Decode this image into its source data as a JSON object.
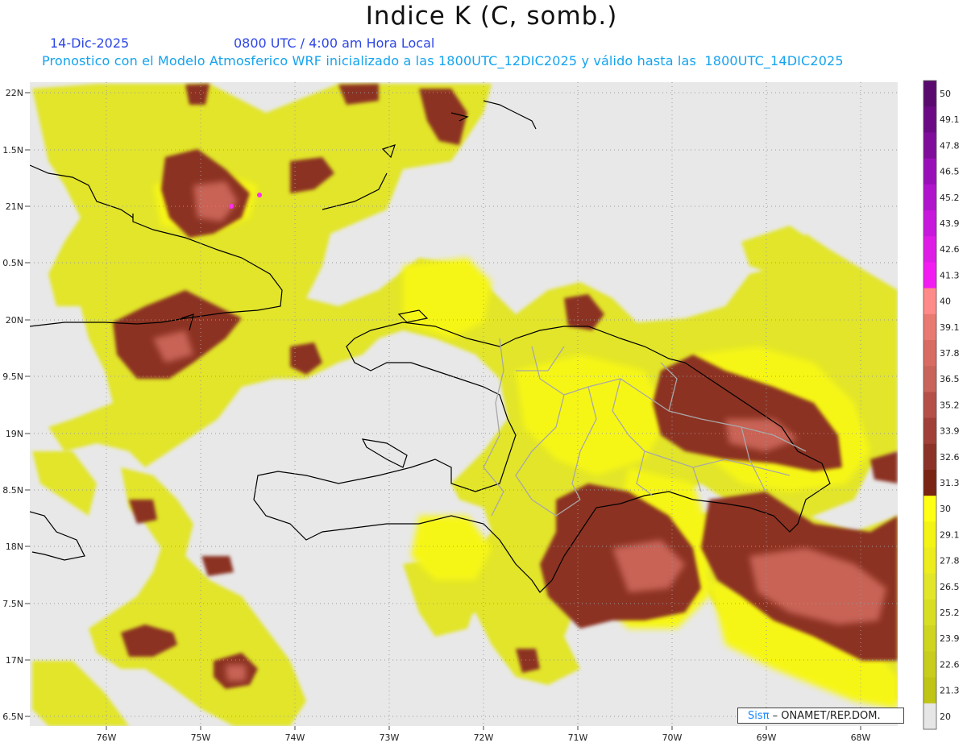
{
  "header": {
    "title": "Indice K (C, somb.)",
    "date": "14-Dic-2025",
    "time": "0800 UTC / 4:00 am Hora Local",
    "description": "Pronostico con el Modelo Atmosferico WRF inicializado a las 1800UTC_12DIC2025 y válido hasta las  1800UTC_14DIC2025"
  },
  "axes": {
    "lat_labels": [
      "22N",
      "1.5N",
      "21N",
      "0.5N",
      "20N",
      "9.5N",
      "19N",
      "8.5N",
      "18N",
      "7.5N",
      "17N",
      "6.5N"
    ],
    "lon_labels": [
      "76W",
      "75W",
      "74W",
      "73W",
      "72W",
      "71W",
      "70W",
      "69W",
      "68W"
    ]
  },
  "colorbar": {
    "labels": [
      "50",
      "49.1",
      "47.8",
      "46.5",
      "45.2",
      "43.9",
      "42.6",
      "41.3",
      "40",
      "39.1",
      "37.8",
      "36.5",
      "35.2",
      "33.9",
      "32.6",
      "31.3",
      "30",
      "29.1",
      "27.8",
      "26.5",
      "25.2",
      "23.9",
      "22.6",
      "21.3",
      "20"
    ],
    "colors": [
      "#5a0a6e",
      "#6b0a84",
      "#800c9c",
      "#9a10b8",
      "#b014cc",
      "#c818dc",
      "#de1ce6",
      "#f21cf2",
      "#ff8a8a",
      "#e87a72",
      "#d86c62",
      "#c8645a",
      "#b45048",
      "#a04038",
      "#8c3228",
      "#7a2414",
      "#ffff14",
      "#f4f414",
      "#ecec1e",
      "#e2e628",
      "#d8de22",
      "#cfd41e",
      "#c8cc1a",
      "#c0c414",
      "#e6e6e6"
    ]
  },
  "credit": {
    "brand": "Sisπ",
    "text": " – ONAMET/REP.DOM."
  }
}
